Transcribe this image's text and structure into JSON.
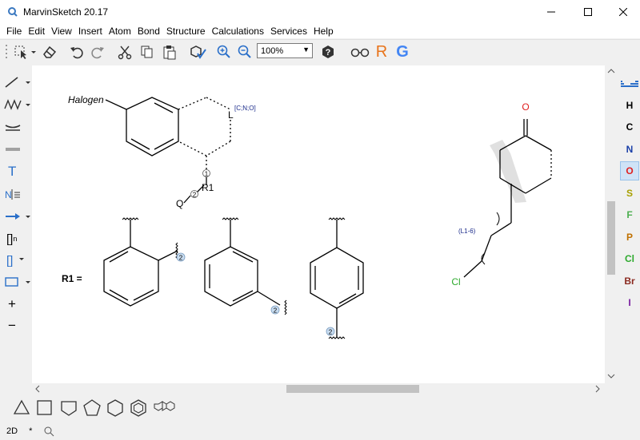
{
  "window": {
    "title": "MarvinSketch 20.17"
  },
  "menu": {
    "items": [
      "File",
      "Edit",
      "View",
      "Insert",
      "Atom",
      "Bond",
      "Structure",
      "Calculations",
      "Services",
      "Help"
    ]
  },
  "toolbar": {
    "zoom_value": "100%",
    "icons": [
      "select-icon",
      "eraser-icon",
      "undo-icon",
      "redo-icon",
      "cut-icon",
      "copy-icon",
      "paste-icon",
      "clean-icon",
      "zoom-in-icon",
      "zoom-out-icon",
      "help-icon",
      "glasses-icon",
      "r-icon",
      "g-icon"
    ],
    "r_letter": "R",
    "g_letter": "G"
  },
  "left_tools": {
    "text_tool": "T",
    "bracket_n": "[]",
    "bracket_n_sub": "n",
    "bracket": "[]",
    "plus": "+",
    "minus": "−"
  },
  "periodic": {
    "elements": [
      {
        "symbol": "H",
        "color": "#000000"
      },
      {
        "symbol": "C",
        "color": "#000000"
      },
      {
        "symbol": "N",
        "color": "#1a3fa8"
      },
      {
        "symbol": "O",
        "color": "#e02020"
      },
      {
        "symbol": "S",
        "color": "#a8a000"
      },
      {
        "symbol": "F",
        "color": "#4caf50"
      },
      {
        "symbol": "P",
        "color": "#c07000"
      },
      {
        "symbol": "Cl",
        "color": "#2eaa2e"
      },
      {
        "symbol": "Br",
        "color": "#8b2a20"
      },
      {
        "symbol": "I",
        "color": "#7a1fa0"
      }
    ],
    "selected": "O"
  },
  "canvas": {
    "halogen_label": "Halogen",
    "l_label": "L",
    "l_list": "[C;N;O]",
    "r1_label": "R1",
    "q_label": "Q",
    "attach_1": "1",
    "attach_2": "2",
    "r1_def_label": "R1 =",
    "o_label": "O",
    "cl_label": "Cl",
    "link_label": "(L1-6)"
  },
  "status": {
    "mode": "2D",
    "star": "*"
  }
}
